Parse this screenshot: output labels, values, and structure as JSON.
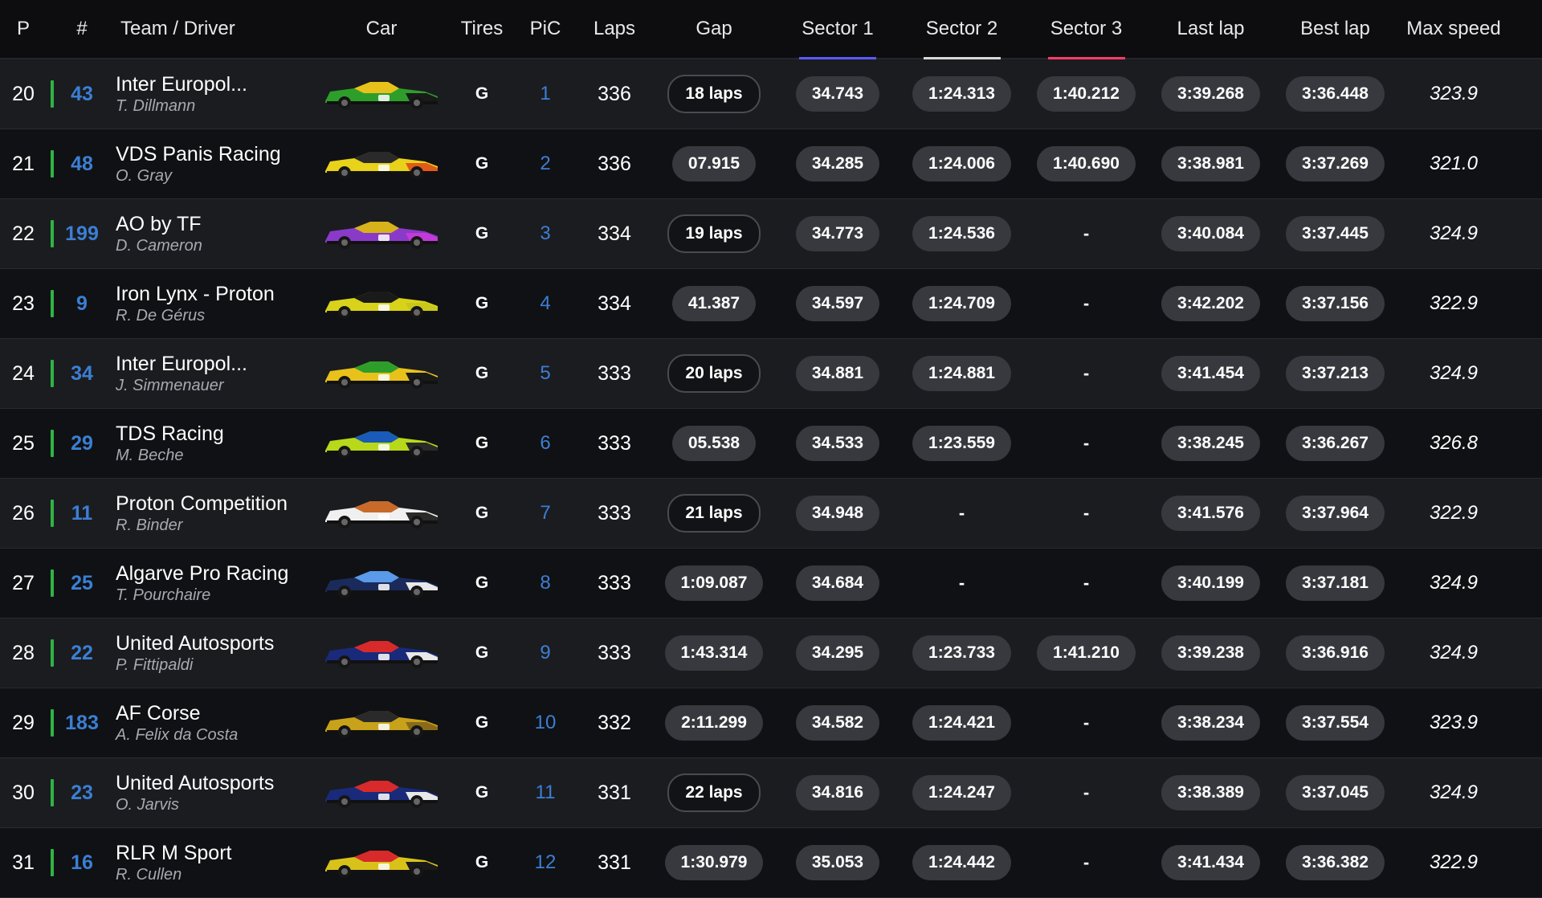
{
  "header": {
    "p": "P",
    "num": "#",
    "team": "Team / Driver",
    "car": "Car",
    "tires": "Tires",
    "pic": "PiC",
    "laps": "Laps",
    "gap": "Gap",
    "s1": "Sector 1",
    "s2": "Sector 2",
    "s3": "Sector 3",
    "last": "Last lap",
    "best": "Best lap",
    "max": "Max speed"
  },
  "colors": {
    "sector1": "#5b5bff",
    "sector2": "#d8d8d8",
    "sector3": "#ff3b6b",
    "class_bar": "#2fb344",
    "car_number": "#3b7fd4"
  },
  "rows": [
    {
      "pos": "20",
      "num": "43",
      "team": "Inter Europol...",
      "driver": "T. Dillmann",
      "tire": "G",
      "pic": "1",
      "laps": "336",
      "gap": "18 laps",
      "gap_outlined": true,
      "s1": "34.743",
      "s2": "1:24.313",
      "s3": "1:40.212",
      "last": "3:39.268",
      "best": "3:36.448",
      "max": "323.9",
      "livery": [
        "#2e9e2a",
        "#e8c21a",
        "#1a1a1a"
      ]
    },
    {
      "pos": "21",
      "num": "48",
      "team": "VDS Panis Racing",
      "driver": "O. Gray",
      "tire": "G",
      "pic": "2",
      "laps": "336",
      "gap": "07.915",
      "gap_outlined": false,
      "s1": "34.285",
      "s2": "1:24.006",
      "s3": "1:40.690",
      "last": "3:38.981",
      "best": "3:37.269",
      "max": "321.0",
      "livery": [
        "#e8d21a",
        "#2a2a2a",
        "#e05a1a"
      ]
    },
    {
      "pos": "22",
      "num": "199",
      "team": "AO by TF",
      "driver": "D. Cameron",
      "tire": "G",
      "pic": "3",
      "laps": "334",
      "gap": "19 laps",
      "gap_outlined": true,
      "s1": "34.773",
      "s2": "1:24.536",
      "s3": "-",
      "last": "3:40.084",
      "best": "3:37.445",
      "max": "324.9",
      "livery": [
        "#8a3ac8",
        "#d8b21a",
        "#c23ad8"
      ]
    },
    {
      "pos": "23",
      "num": "9",
      "team": "Iron Lynx - Proton",
      "driver": "R. De Gérus",
      "tire": "G",
      "pic": "4",
      "laps": "334",
      "gap": "41.387",
      "gap_outlined": false,
      "s1": "34.597",
      "s2": "1:24.709",
      "s3": "-",
      "last": "3:42.202",
      "best": "3:37.156",
      "max": "322.9",
      "livery": [
        "#d8d21a",
        "#1a1a1a",
        "#c8c81a"
      ]
    },
    {
      "pos": "24",
      "num": "34",
      "team": "Inter Europol...",
      "driver": "J. Simmenauer",
      "tire": "G",
      "pic": "5",
      "laps": "333",
      "gap": "20 laps",
      "gap_outlined": true,
      "s1": "34.881",
      "s2": "1:24.881",
      "s3": "-",
      "last": "3:41.454",
      "best": "3:37.213",
      "max": "324.9",
      "livery": [
        "#e8c21a",
        "#2e9e2a",
        "#1a1a1a"
      ]
    },
    {
      "pos": "25",
      "num": "29",
      "team": "TDS Racing",
      "driver": "M. Beche",
      "tire": "G",
      "pic": "6",
      "laps": "333",
      "gap": "05.538",
      "gap_outlined": false,
      "s1": "34.533",
      "s2": "1:23.559",
      "s3": "-",
      "last": "3:38.245",
      "best": "3:36.267",
      "max": "326.8",
      "livery": [
        "#b8d81a",
        "#1a5ab8",
        "#2a2a2a"
      ]
    },
    {
      "pos": "26",
      "num": "11",
      "team": "Proton Competition",
      "driver": "R. Binder",
      "tire": "G",
      "pic": "7",
      "laps": "333",
      "gap": "21 laps",
      "gap_outlined": true,
      "s1": "34.948",
      "s2": "-",
      "s3": "-",
      "last": "3:41.576",
      "best": "3:37.964",
      "max": "322.9",
      "livery": [
        "#f0f0f0",
        "#c86a2a",
        "#2a2a2a"
      ]
    },
    {
      "pos": "27",
      "num": "25",
      "team": "Algarve Pro Racing",
      "driver": "T. Pourchaire",
      "tire": "G",
      "pic": "8",
      "laps": "333",
      "gap": "1:09.087",
      "gap_outlined": false,
      "s1": "34.684",
      "s2": "-",
      "s3": "-",
      "last": "3:40.199",
      "best": "3:37.181",
      "max": "324.9",
      "livery": [
        "#1a2a5a",
        "#5a9ae8",
        "#e8e8e8"
      ]
    },
    {
      "pos": "28",
      "num": "22",
      "team": "United Autosports",
      "driver": "P. Fittipaldi",
      "tire": "G",
      "pic": "9",
      "laps": "333",
      "gap": "1:43.314",
      "gap_outlined": false,
      "s1": "34.295",
      "s2": "1:23.733",
      "s3": "1:41.210",
      "last": "3:39.238",
      "best": "3:36.916",
      "max": "324.9",
      "livery": [
        "#1a2a7a",
        "#d82a2a",
        "#e8e8e8"
      ]
    },
    {
      "pos": "29",
      "num": "183",
      "team": "AF Corse",
      "driver": "A. Felix da Costa",
      "tire": "G",
      "pic": "10",
      "laps": "332",
      "gap": "2:11.299",
      "gap_outlined": false,
      "s1": "34.582",
      "s2": "1:24.421",
      "s3": "-",
      "last": "3:38.234",
      "best": "3:37.554",
      "max": "323.9",
      "livery": [
        "#c8a21a",
        "#2a2a2a",
        "#8a6a1a"
      ]
    },
    {
      "pos": "30",
      "num": "23",
      "team": "United Autosports",
      "driver": "O. Jarvis",
      "tire": "G",
      "pic": "11",
      "laps": "331",
      "gap": "22 laps",
      "gap_outlined": true,
      "s1": "34.816",
      "s2": "1:24.247",
      "s3": "-",
      "last": "3:38.389",
      "best": "3:37.045",
      "max": "324.9",
      "livery": [
        "#1a2a7a",
        "#d82a2a",
        "#e8e8e8"
      ]
    },
    {
      "pos": "31",
      "num": "16",
      "team": "RLR M Sport",
      "driver": "R. Cullen",
      "tire": "G",
      "pic": "12",
      "laps": "331",
      "gap": "1:30.979",
      "gap_outlined": false,
      "s1": "35.053",
      "s2": "1:24.442",
      "s3": "-",
      "last": "3:41.434",
      "best": "3:36.382",
      "max": "322.9",
      "livery": [
        "#d8c21a",
        "#d82a2a",
        "#1a1a1a"
      ]
    }
  ]
}
